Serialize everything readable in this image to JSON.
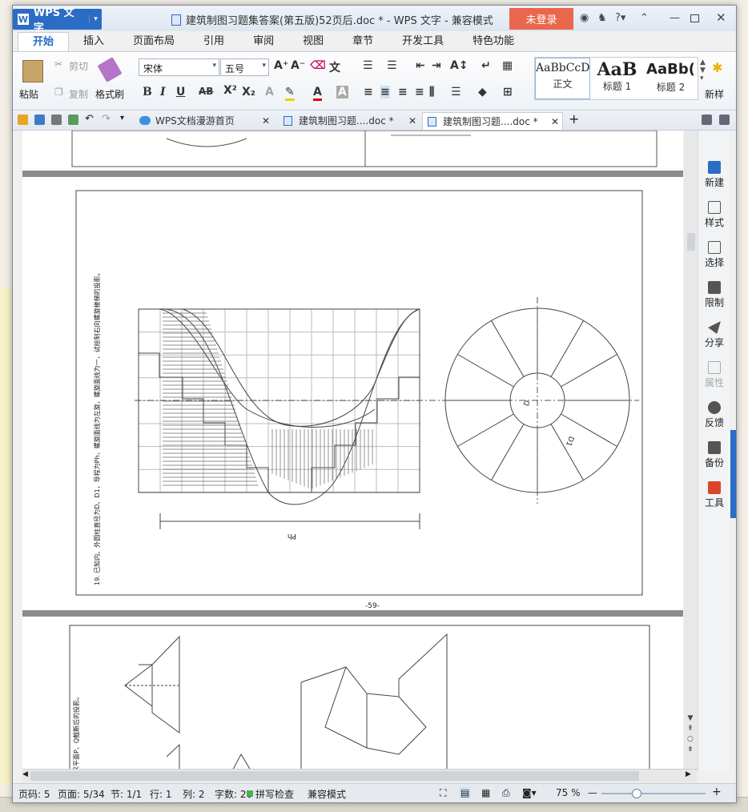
{
  "app": {
    "name": "WPS 文字",
    "title": "建筑制图习题集答案(第五版)52页后.doc * - WPS 文字 - 兼容模式",
    "login_label": "未登录"
  },
  "ribbon_tabs": [
    "开始",
    "插入",
    "页面布局",
    "引用",
    "审阅",
    "视图",
    "章节",
    "开发工具",
    "特色功能"
  ],
  "ribbon": {
    "paste": "粘贴",
    "cut": "剪切",
    "copy": "复制",
    "format_painter": "格式刷",
    "font_name": "宋体",
    "font_size": "五号",
    "styles": [
      {
        "preview": "AaBbCcD",
        "label": "正文"
      },
      {
        "preview": "AaB",
        "label": "标题 1"
      },
      {
        "preview": "AaBb(",
        "label": "标题 2"
      }
    ],
    "new_style": "新样"
  },
  "doc_tabs": [
    {
      "label": "WPS文档漫游首页"
    },
    {
      "label": "建筑制图习题....doc *"
    },
    {
      "label": "建筑制图习题....doc *"
    }
  ],
  "sidebar": [
    {
      "label": "新建",
      "icon": "new-doc-icon",
      "color": "#2b6cc4"
    },
    {
      "label": "样式",
      "icon": "style-icon",
      "color": "#555"
    },
    {
      "label": "选择",
      "icon": "select-icon",
      "color": "#555"
    },
    {
      "label": "限制",
      "icon": "lock-icon",
      "color": "#555"
    },
    {
      "label": "分享",
      "icon": "share-icon",
      "color": "#555"
    },
    {
      "label": "属性",
      "icon": "properties-icon",
      "color": "#aaa"
    },
    {
      "label": "反馈",
      "icon": "feedback-icon",
      "color": "#555"
    },
    {
      "label": "备份",
      "icon": "backup-icon",
      "color": "#555"
    },
    {
      "label": "工具",
      "icon": "toolbox-icon",
      "color": "#d9472b"
    }
  ],
  "page": {
    "caption": "19. 已知内、外圆柱直径为D、D1，导程为Ph，螺旋面线为左旋，螺旋面线为一，试绘制右向螺旋楼梯的投影。",
    "page_number": "-59-",
    "dim_d": "D",
    "dim_d1": "D1",
    "dim_ph": "Ph",
    "next_caption": "求平面P、Q截断后的投影。"
  },
  "status": {
    "page_code": "页码: 5",
    "pages": "页面: 5/34",
    "section": "节: 1/1",
    "row": "行: 1",
    "col": "列: 2",
    "words": "字数: 20",
    "spell": "拼写检查",
    "mode": "兼容模式",
    "zoom": "75 %"
  }
}
